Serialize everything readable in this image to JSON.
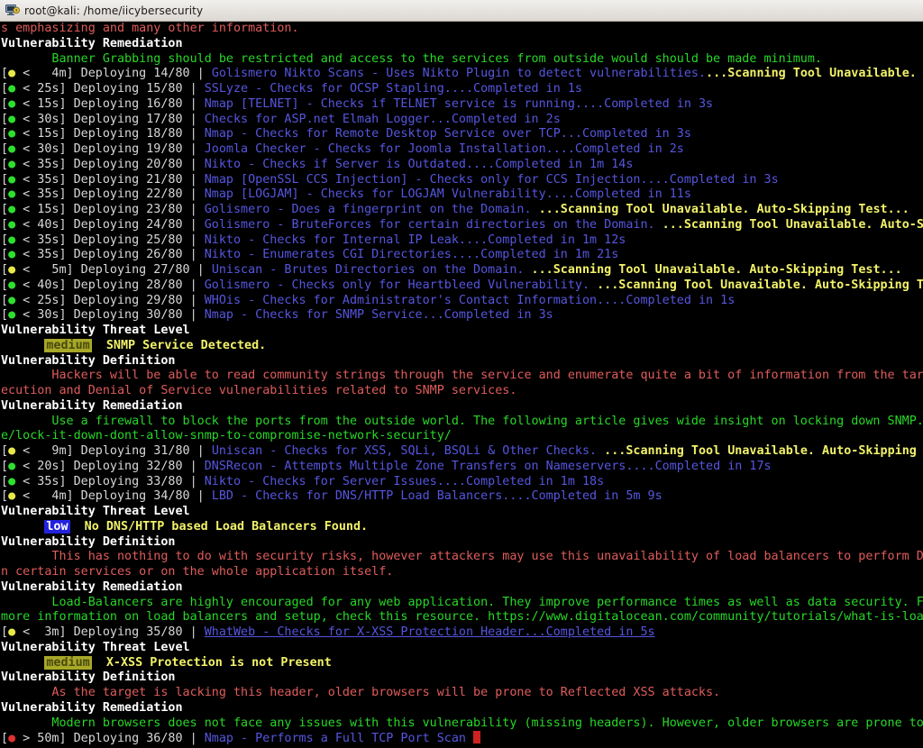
{
  "window": {
    "title": "root@kali: /home/iicybersecurity",
    "icon": "terminal-icon"
  },
  "colors": {
    "background": "#000000",
    "white": "#d8d8d8",
    "bold_white": "#ffffff",
    "red": "#e05c5c",
    "green": "#27d827",
    "blue": "#5656e0",
    "bold_yellow": "#f2f26a",
    "dot_green": "#2ee02e",
    "dot_yellow": "#e8e84a",
    "dot_red": "#e03030",
    "badge_medium_bg": "#a8a828",
    "badge_low_bg": "#2222dd",
    "cursor": "#cc2222"
  },
  "labels": {
    "threat_level": "Vulnerability Threat Level",
    "definition": "Vulnerability Definition",
    "remediation": "Vulnerability Remediation",
    "badge_medium": "medium",
    "badge_low": "low"
  },
  "terminal_lines": [
    {
      "id": "wrap-banner-definition-tail",
      "type": "wrapped-text",
      "color": "red",
      "text": "s emphasizing and many other information."
    },
    {
      "id": "heading-remediation-1",
      "type": "heading",
      "text": "Vulnerability Remediation"
    },
    {
      "id": "remediation-banner-grabbing",
      "type": "indent-text",
      "color": "green",
      "text": "Banner Grabbing should be restricted and access to the services from outside would should be made minimum."
    },
    {
      "id": "deploy-14",
      "type": "deploy",
      "dot": "yellow",
      "time": "<   4m",
      "counter": "Deploying 14/80",
      "tool": "Golismero Nikto Scans - Uses Nikto Plugin to detect vulnerabilities.",
      "status": "...Scanning Tool Unavailable. Auto-Skipping Test...",
      "status_style": "bold_yellow"
    },
    {
      "id": "deploy-15",
      "type": "deploy",
      "dot": "green",
      "time": "< 25s",
      "counter": "Deploying 15/80",
      "tool": "SSLyze - Checks for OCSP Stapling....Completed in 1s",
      "status": "",
      "status_style": "blue"
    },
    {
      "id": "deploy-16",
      "type": "deploy",
      "dot": "green",
      "time": "< 15s",
      "counter": "Deploying 16/80",
      "tool": "Nmap [TELNET] - Checks if TELNET service is running....Completed in 3s",
      "status": "",
      "status_style": "blue"
    },
    {
      "id": "deploy-17",
      "type": "deploy",
      "dot": "green",
      "time": "< 30s",
      "counter": "Deploying 17/80",
      "tool": "Checks for ASP.net Elmah Logger...Completed in 2s",
      "status": "",
      "status_style": "blue"
    },
    {
      "id": "deploy-18",
      "type": "deploy",
      "dot": "green",
      "time": "< 15s",
      "counter": "Deploying 18/80",
      "tool": "Nmap - Checks for Remote Desktop Service over TCP...Completed in 3s",
      "status": "",
      "status_style": "blue"
    },
    {
      "id": "deploy-19",
      "type": "deploy",
      "dot": "green",
      "time": "< 30s",
      "counter": "Deploying 19/80",
      "tool": "Joomla Checker - Checks for Joomla Installation....Completed in 2s",
      "status": "",
      "status_style": "blue"
    },
    {
      "id": "deploy-20",
      "type": "deploy",
      "dot": "green",
      "time": "< 35s",
      "counter": "Deploying 20/80",
      "tool": "Nikto - Checks if Server is Outdated....Completed in 1m 14s",
      "status": "",
      "status_style": "blue"
    },
    {
      "id": "deploy-21",
      "type": "deploy",
      "dot": "green",
      "time": "< 35s",
      "counter": "Deploying 21/80",
      "tool": "Nmap [OpenSSL CCS Injection] - Checks only for CCS Injection....Completed in 3s",
      "status": "",
      "status_style": "blue"
    },
    {
      "id": "deploy-22",
      "type": "deploy",
      "dot": "green",
      "time": "< 35s",
      "counter": "Deploying 22/80",
      "tool": "Nmap [LOGJAM] - Checks for LOGJAM Vulnerability....Completed in 11s",
      "status": "",
      "status_style": "blue"
    },
    {
      "id": "deploy-23",
      "type": "deploy",
      "dot": "green",
      "time": "< 15s",
      "counter": "Deploying 23/80",
      "tool": "Golismero - Does a fingerprint on the Domain.",
      "status": " ...Scanning Tool Unavailable. Auto-Skipping Test...",
      "status_style": "bold_yellow"
    },
    {
      "id": "deploy-24",
      "type": "deploy",
      "dot": "green",
      "time": "< 40s",
      "counter": "Deploying 24/80",
      "tool": "Golismero - BruteForces for certain directories on the Domain.",
      "status": " ...Scanning Tool Unavailable. Auto-Skipping Test...",
      "status_style": "bold_yellow"
    },
    {
      "id": "deploy-25",
      "type": "deploy",
      "dot": "green",
      "time": "< 35s",
      "counter": "Deploying 25/80",
      "tool": "Nikto - Checks for Internal IP Leak....Completed in 1m 12s",
      "status": "",
      "status_style": "blue"
    },
    {
      "id": "deploy-26",
      "type": "deploy",
      "dot": "green",
      "time": "< 35s",
      "counter": "Deploying 26/80",
      "tool": "Nikto - Enumerates CGI Directories....Completed in 1m 21s",
      "status": "",
      "status_style": "blue"
    },
    {
      "id": "deploy-27",
      "type": "deploy",
      "dot": "yellow",
      "time": "<   5m",
      "counter": "Deploying 27/80",
      "tool": "Uniscan - Brutes Directories on the Domain.",
      "status": " ...Scanning Tool Unavailable. Auto-Skipping Test...",
      "status_style": "bold_yellow"
    },
    {
      "id": "deploy-28",
      "type": "deploy",
      "dot": "green",
      "time": "< 40s",
      "counter": "Deploying 28/80",
      "tool": "Golismero - Checks only for Heartbleed Vulnerability.",
      "status": " ...Scanning Tool Unavailable. Auto-Skipping Test...",
      "status_style": "bold_yellow"
    },
    {
      "id": "deploy-29",
      "type": "deploy",
      "dot": "green",
      "time": "< 25s",
      "counter": "Deploying 29/80",
      "tool": "WHOis - Checks for Administrator's Contact Information....Completed in 1s",
      "status": "",
      "status_style": "blue"
    },
    {
      "id": "deploy-30",
      "type": "deploy",
      "dot": "green",
      "time": "< 30s",
      "counter": "Deploying 30/80",
      "tool": "Nmap - Checks for SNMP Service...Completed in 3s",
      "status": "",
      "status_style": "blue"
    },
    {
      "id": "heading-threat-snmp",
      "type": "heading",
      "text": "Vulnerability Threat Level"
    },
    {
      "id": "threat-snmp",
      "type": "badge-line",
      "badge": "medium",
      "badge_text": "medium",
      "text": "SNMP Service Detected."
    },
    {
      "id": "heading-definition-snmp",
      "type": "heading",
      "text": "Vulnerability Definition"
    },
    {
      "id": "definition-snmp-1",
      "type": "indent-text",
      "color": "red",
      "text": "Hackers will be able to read community strings through the service and enumerate quite a bit of information from the target. Moreover there are several Remote Code Ex"
    },
    {
      "id": "definition-snmp-2",
      "type": "wrapped-text",
      "color": "red",
      "text": "ecution and Denial of Service vulnerabilities related to SNMP services."
    },
    {
      "id": "heading-remediation-snmp",
      "type": "heading",
      "text": "Vulnerability Remediation"
    },
    {
      "id": "remediation-snmp-1",
      "type": "indent-text",
      "color": "green",
      "text": "Use a firewall to block the ports from the outside world. The following article gives wide insight on locking down SNMP. https://www.techrepublic.com/articl"
    },
    {
      "id": "remediation-snmp-2",
      "type": "wrapped-text",
      "color": "green",
      "text": "e/lock-it-down-dont-allow-snmp-to-compromise-network-security/"
    },
    {
      "id": "deploy-31",
      "type": "deploy",
      "dot": "yellow",
      "time": "<   9m",
      "counter": "Deploying 31/80",
      "tool": "Uniscan - Checks for XSS, SQLi, BSQLi & Other Checks.",
      "status": " ...Scanning Tool Unavailable. Auto-Skipping Test...",
      "status_style": "bold_yellow"
    },
    {
      "id": "deploy-32",
      "type": "deploy",
      "dot": "green",
      "time": "< 20s",
      "counter": "Deploying 32/80",
      "tool": "DNSRecon - Attempts Multiple Zone Transfers on Nameservers....Completed in 17s",
      "status": "",
      "status_style": "blue"
    },
    {
      "id": "deploy-33",
      "type": "deploy",
      "dot": "green",
      "time": "< 35s",
      "counter": "Deploying 33/80",
      "tool": "Nikto - Checks for Server Issues....Completed in 1m 18s",
      "status": "",
      "status_style": "blue"
    },
    {
      "id": "deploy-34",
      "type": "deploy",
      "dot": "yellow",
      "time": "<   4m",
      "counter": "Deploying 34/80",
      "tool": "LBD - Checks for DNS/HTTP Load Balancers....Completed in 5m 9s",
      "status": "",
      "status_style": "blue"
    },
    {
      "id": "heading-threat-lb",
      "type": "heading",
      "text": "Vulnerability Threat Level"
    },
    {
      "id": "threat-lb",
      "type": "badge-line",
      "badge": "low",
      "badge_text": "low",
      "text": "No DNS/HTTP based Load Balancers Found."
    },
    {
      "id": "heading-definition-lb",
      "type": "heading",
      "text": "Vulnerability Definition"
    },
    {
      "id": "definition-lb-1",
      "type": "indent-text",
      "color": "red",
      "text": "This has nothing to do with security risks, however attackers may use this unavailability of load balancers to perform DoS attacks o"
    },
    {
      "id": "definition-lb-2",
      "type": "wrapped-text",
      "color": "red",
      "text": "n certain services or on the whole application itself."
    },
    {
      "id": "heading-remediation-lb",
      "type": "heading",
      "text": "Vulnerability Remediation"
    },
    {
      "id": "remediation-lb-1",
      "type": "indent-text",
      "color": "green",
      "text": "Load-Balancers are highly encouraged for any web application. They improve performance times as well as data security. For"
    },
    {
      "id": "remediation-lb-2",
      "type": "wrapped-text",
      "color": "green",
      "text": "more information on load balancers and setup, check this resource. https://www.digitalocean.com/community/tutorials/what-is-load-bala"
    },
    {
      "id": "deploy-35",
      "type": "deploy",
      "dot": "yellow",
      "time": "<  3m",
      "counter": "Deploying 35/80",
      "tool": "WhatWeb - Checks for X-XSS Protection Header...Completed in 5s",
      "status": "",
      "status_style": "blue-underline"
    },
    {
      "id": "heading-threat-xxss",
      "type": "heading",
      "text": "Vulnerability Threat Level"
    },
    {
      "id": "threat-xxss",
      "type": "badge-line",
      "badge": "medium",
      "badge_text": "medium",
      "text": "X-XSS Protection is not Present"
    },
    {
      "id": "heading-definition-xxss",
      "type": "heading",
      "text": "Vulnerability Definition"
    },
    {
      "id": "definition-xxss",
      "type": "indent-text",
      "color": "red",
      "text": "As the target is lacking this header, older browsers will be prone to Reflected XSS attacks."
    },
    {
      "id": "heading-remediation-xxss",
      "type": "heading",
      "text": "Vulnerability Remediation"
    },
    {
      "id": "remediation-xxss",
      "type": "indent-text",
      "color": "green",
      "text": "Modern browsers does not face any issues with this vulnerability (missing headers). However, older browsers are prone to"
    },
    {
      "id": "deploy-36",
      "type": "deploy",
      "dot": "red",
      "time": "> 50m",
      "counter": "Deploying 36/80",
      "tool": "Nmap - Performs a Full TCP Port Scan ",
      "status": "",
      "status_style": "blue",
      "cursor": true
    }
  ]
}
